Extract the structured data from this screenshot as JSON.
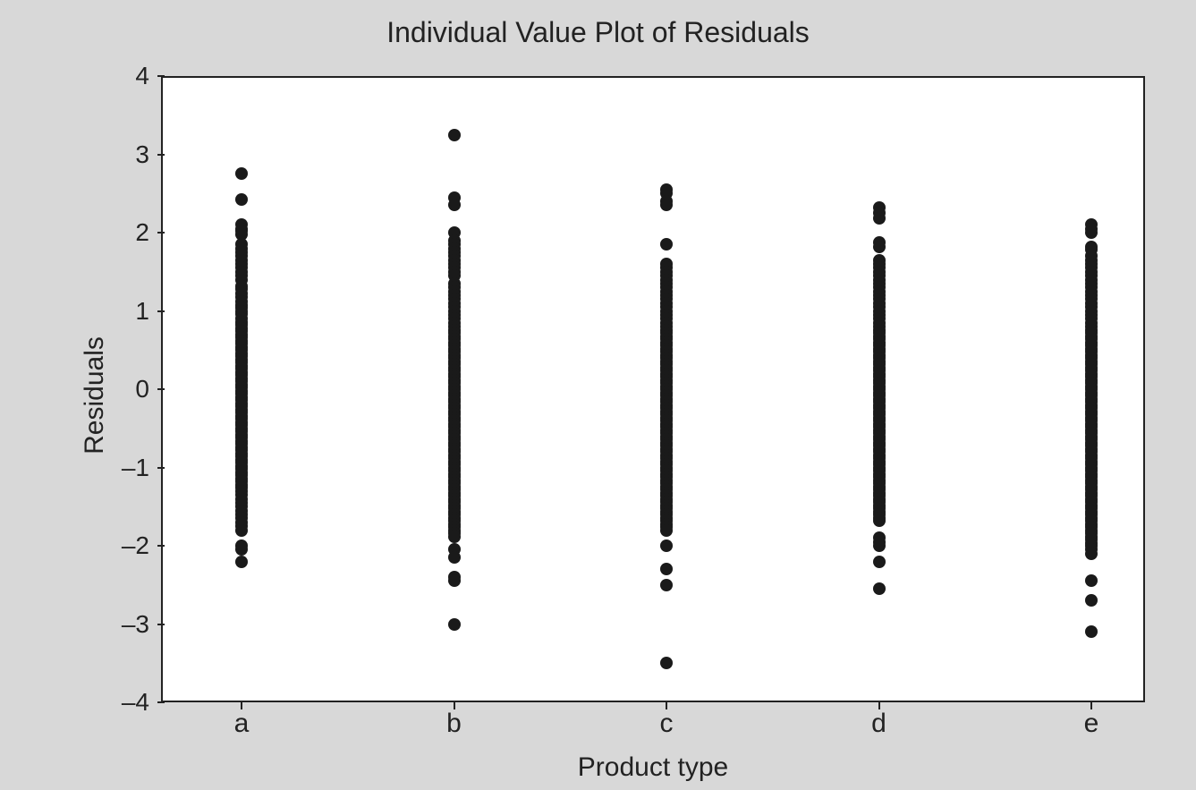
{
  "chart_data": {
    "type": "scatter",
    "title": "Individual Value Plot of Residuals",
    "xlabel": "Product type",
    "ylabel": "Residuals",
    "ylim": [
      -4,
      4
    ],
    "y_ticks": [
      -4,
      -3,
      -2,
      -1,
      0,
      1,
      2,
      3,
      4
    ],
    "categories": [
      "a",
      "b",
      "c",
      "d",
      "e"
    ],
    "series": [
      {
        "name": "a",
        "values": [
          2.75,
          2.42,
          2.1,
          2.05,
          2.02,
          1.98,
          1.85,
          1.8,
          1.75,
          1.7,
          1.65,
          1.6,
          1.55,
          1.5,
          1.45,
          1.4,
          1.32,
          1.28,
          1.22,
          1.18,
          1.12,
          1.08,
          1.04,
          1.0,
          0.96,
          0.9,
          0.86,
          0.82,
          0.78,
          0.74,
          0.7,
          0.66,
          0.62,
          0.58,
          0.54,
          0.5,
          0.46,
          0.42,
          0.38,
          0.34,
          0.3,
          0.26,
          0.22,
          0.18,
          0.14,
          0.1,
          0.06,
          0.02,
          -0.02,
          -0.06,
          -0.1,
          -0.14,
          -0.18,
          -0.22,
          -0.26,
          -0.3,
          -0.34,
          -0.38,
          -0.42,
          -0.46,
          -0.5,
          -0.54,
          -0.58,
          -0.62,
          -0.66,
          -0.7,
          -0.74,
          -0.78,
          -0.82,
          -0.86,
          -0.9,
          -0.94,
          -0.98,
          -1.02,
          -1.06,
          -1.1,
          -1.14,
          -1.18,
          -1.22,
          -1.26,
          -1.3,
          -1.35,
          -1.4,
          -1.45,
          -1.5,
          -1.55,
          -1.6,
          -1.65,
          -1.7,
          -1.75,
          -1.8,
          -2.0,
          -2.05,
          -2.2
        ]
      },
      {
        "name": "b",
        "values": [
          3.25,
          2.45,
          2.35,
          2.0,
          1.9,
          1.85,
          1.8,
          1.75,
          1.7,
          1.65,
          1.6,
          1.55,
          1.5,
          1.45,
          1.35,
          1.3,
          1.25,
          1.2,
          1.15,
          1.1,
          1.05,
          1.0,
          0.95,
          0.9,
          0.85,
          0.8,
          0.76,
          0.72,
          0.68,
          0.64,
          0.6,
          0.56,
          0.52,
          0.48,
          0.44,
          0.4,
          0.36,
          0.32,
          0.28,
          0.24,
          0.2,
          0.16,
          0.12,
          0.08,
          0.04,
          0.0,
          -0.04,
          -0.08,
          -0.12,
          -0.16,
          -0.2,
          -0.24,
          -0.28,
          -0.32,
          -0.36,
          -0.4,
          -0.44,
          -0.48,
          -0.52,
          -0.56,
          -0.6,
          -0.64,
          -0.68,
          -0.72,
          -0.76,
          -0.8,
          -0.84,
          -0.88,
          -0.92,
          -0.96,
          -1.0,
          -1.04,
          -1.08,
          -1.12,
          -1.16,
          -1.2,
          -1.24,
          -1.28,
          -1.32,
          -1.36,
          -1.4,
          -1.44,
          -1.48,
          -1.52,
          -1.56,
          -1.6,
          -1.64,
          -1.68,
          -1.72,
          -1.76,
          -1.8,
          -1.84,
          -1.88,
          -2.05,
          -2.15,
          -2.4,
          -2.45,
          -3.0
        ]
      },
      {
        "name": "c",
        "values": [
          2.55,
          2.5,
          2.4,
          2.35,
          1.85,
          1.6,
          1.55,
          1.5,
          1.45,
          1.4,
          1.35,
          1.3,
          1.25,
          1.2,
          1.15,
          1.1,
          1.05,
          1.0,
          0.95,
          0.9,
          0.85,
          0.8,
          0.76,
          0.72,
          0.68,
          0.64,
          0.6,
          0.56,
          0.52,
          0.48,
          0.44,
          0.4,
          0.36,
          0.32,
          0.28,
          0.24,
          0.2,
          0.16,
          0.12,
          0.08,
          0.04,
          0.0,
          -0.04,
          -0.08,
          -0.12,
          -0.16,
          -0.2,
          -0.24,
          -0.28,
          -0.32,
          -0.36,
          -0.4,
          -0.44,
          -0.48,
          -0.52,
          -0.56,
          -0.6,
          -0.64,
          -0.68,
          -0.72,
          -0.76,
          -0.8,
          -0.84,
          -0.88,
          -0.92,
          -0.96,
          -1.0,
          -1.04,
          -1.08,
          -1.12,
          -1.16,
          -1.2,
          -1.24,
          -1.28,
          -1.32,
          -1.36,
          -1.4,
          -1.44,
          -1.48,
          -1.52,
          -1.56,
          -1.6,
          -1.64,
          -1.68,
          -1.72,
          -1.76,
          -1.8,
          -2.0,
          -2.3,
          -2.5,
          -3.5
        ]
      },
      {
        "name": "d",
        "values": [
          2.32,
          2.25,
          2.18,
          1.88,
          1.82,
          1.65,
          1.6,
          1.55,
          1.5,
          1.45,
          1.4,
          1.35,
          1.3,
          1.25,
          1.2,
          1.15,
          1.1,
          1.05,
          1.0,
          0.95,
          0.9,
          0.85,
          0.8,
          0.76,
          0.72,
          0.68,
          0.64,
          0.6,
          0.56,
          0.52,
          0.48,
          0.44,
          0.4,
          0.36,
          0.32,
          0.28,
          0.24,
          0.2,
          0.16,
          0.12,
          0.08,
          0.04,
          0.0,
          -0.04,
          -0.08,
          -0.12,
          -0.16,
          -0.2,
          -0.24,
          -0.28,
          -0.32,
          -0.36,
          -0.4,
          -0.44,
          -0.48,
          -0.52,
          -0.56,
          -0.6,
          -0.64,
          -0.68,
          -0.72,
          -0.76,
          -0.8,
          -0.84,
          -0.88,
          -0.92,
          -0.96,
          -1.0,
          -1.04,
          -1.08,
          -1.12,
          -1.16,
          -1.2,
          -1.24,
          -1.28,
          -1.32,
          -1.36,
          -1.4,
          -1.44,
          -1.48,
          -1.52,
          -1.56,
          -1.6,
          -1.64,
          -1.68,
          -1.9,
          -1.95,
          -2.0,
          -2.2,
          -2.55
        ]
      },
      {
        "name": "e",
        "values": [
          2.1,
          2.05,
          2.0,
          1.82,
          1.78,
          1.7,
          1.65,
          1.6,
          1.55,
          1.5,
          1.45,
          1.4,
          1.35,
          1.3,
          1.25,
          1.2,
          1.15,
          1.1,
          1.05,
          1.0,
          0.95,
          0.9,
          0.85,
          0.8,
          0.76,
          0.72,
          0.68,
          0.64,
          0.6,
          0.56,
          0.52,
          0.48,
          0.44,
          0.4,
          0.36,
          0.32,
          0.28,
          0.24,
          0.2,
          0.16,
          0.12,
          0.08,
          0.04,
          0.0,
          -0.04,
          -0.08,
          -0.12,
          -0.16,
          -0.2,
          -0.24,
          -0.28,
          -0.32,
          -0.36,
          -0.4,
          -0.44,
          -0.48,
          -0.52,
          -0.56,
          -0.6,
          -0.64,
          -0.68,
          -0.72,
          -0.76,
          -0.8,
          -0.84,
          -0.88,
          -0.92,
          -0.96,
          -1.0,
          -1.04,
          -1.08,
          -1.12,
          -1.16,
          -1.2,
          -1.24,
          -1.28,
          -1.32,
          -1.36,
          -1.4,
          -1.44,
          -1.48,
          -1.52,
          -1.56,
          -1.6,
          -1.64,
          -1.68,
          -1.72,
          -1.76,
          -1.8,
          -1.84,
          -1.88,
          -1.92,
          -1.96,
          -2.0,
          -2.05,
          -2.1,
          -2.45,
          -2.7,
          -3.1
        ]
      }
    ]
  }
}
